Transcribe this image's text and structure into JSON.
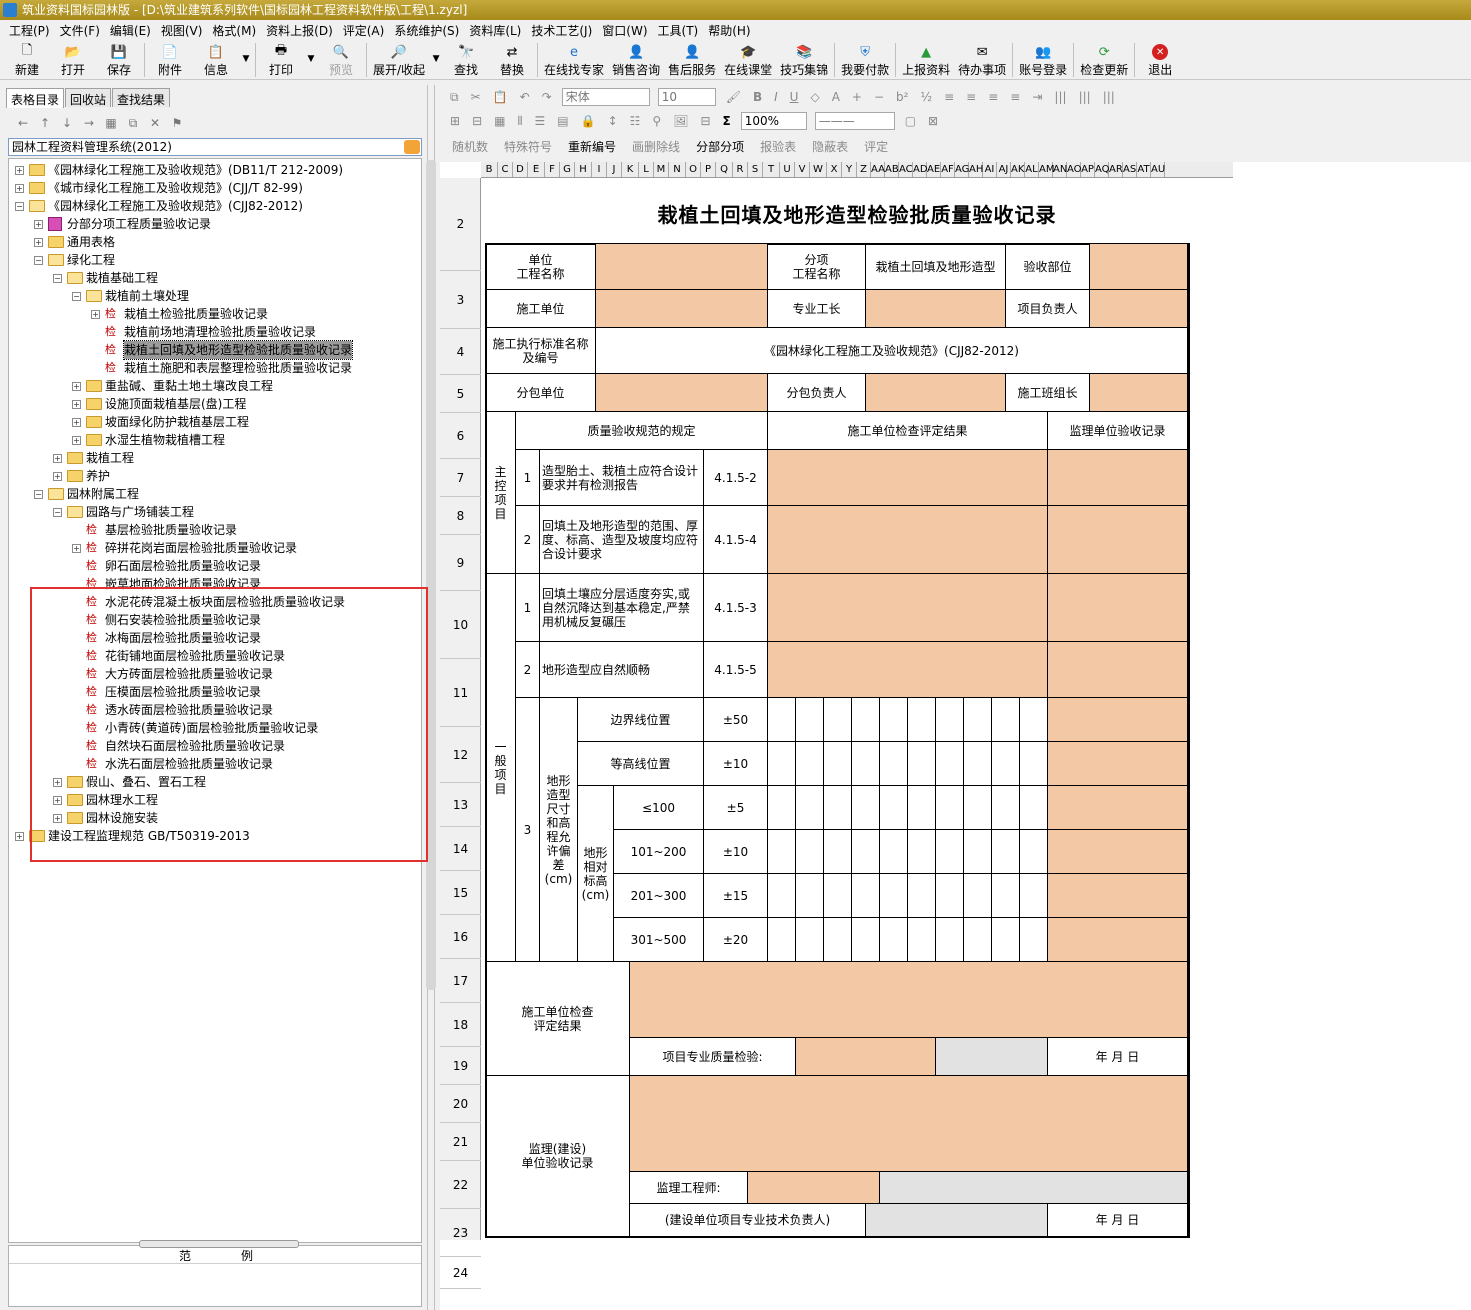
{
  "window": {
    "title": "筑业资料国标园林版 - [D:\\筑业建筑系列软件\\国标园林工程资料软件版\\工程\\1.zyzl]"
  },
  "menu": [
    "工程(P)",
    "文件(F)",
    "编辑(E)",
    "视图(V)",
    "格式(M)",
    "资料上报(D)",
    "评定(A)",
    "系统维护(S)",
    "资料库(L)",
    "技术工艺(J)",
    "窗口(W)",
    "工具(T)",
    "帮助(H)"
  ],
  "toolbar": {
    "new": "新建",
    "open": "打开",
    "save": "保存",
    "attach": "附件",
    "info": "信息",
    "print": "打印",
    "preview": "预览",
    "expand": "展开/收起",
    "find": "查找",
    "replace": "替换",
    "expert": "在线找专家",
    "sales_consult": "销售咨询",
    "after_sales": "售后服务",
    "online_class": "在线课堂",
    "tips": "技巧集锦",
    "pay": "我要付款",
    "report": "上报资料",
    "todo": "待办事项",
    "login": "账号登录",
    "update": "检查更新",
    "exit": "退出"
  },
  "left": {
    "tabs": [
      "表格目录",
      "回收站",
      "查找结果"
    ],
    "system": "园林工程资料管理系统(2012)",
    "tree": [
      {
        "label": "《园林绿化工程施工及验收规范》(DB11/T 212-2009)"
      },
      {
        "label": "《城市绿化工程施工及验收规范》(CJJ/T 82-99)"
      },
      {
        "label": "《园林绿化工程施工及验收规范》(CJJ82-2012)"
      },
      {
        "label": "分部分项工程质量验收记录"
      },
      {
        "label": "通用表格"
      },
      {
        "label": "绿化工程"
      },
      {
        "label": "栽植基础工程"
      },
      {
        "label": "栽植前土壤处理"
      },
      {
        "label": "栽植土检验批质量验收记录"
      },
      {
        "label": "栽植前场地清理检验批质量验收记录"
      },
      {
        "label": "栽植土回填及地形造型检验批质量验收记录"
      },
      {
        "label": "栽植土施肥和表层整理检验批质量验收记录"
      },
      {
        "label": "重盐碱、重黏土地土壤改良工程"
      },
      {
        "label": "设施顶面栽植基层(盘)工程"
      },
      {
        "label": "坡面绿化防护栽植基层工程"
      },
      {
        "label": "水湿生植物栽植槽工程"
      },
      {
        "label": "栽植工程"
      },
      {
        "label": "养护"
      },
      {
        "label": "园林附属工程"
      },
      {
        "label": "园路与广场铺装工程"
      },
      {
        "label": "基层检验批质量验收记录"
      },
      {
        "label": "碎拼花岗岩面层检验批质量验收记录"
      },
      {
        "label": "卵石面层检验批质量验收记录"
      },
      {
        "label": "嵌草地面检验批质量验收记录"
      },
      {
        "label": "水泥花砖混凝土板块面层检验批质量验收记录"
      },
      {
        "label": "侧石安装检验批质量验收记录"
      },
      {
        "label": "冰梅面层检验批质量验收记录"
      },
      {
        "label": "花街铺地面层检验批质量验收记录"
      },
      {
        "label": "大方砖面层检验批质量验收记录"
      },
      {
        "label": "压模面层检验批质量验收记录"
      },
      {
        "label": "透水砖面层检验批质量验收记录"
      },
      {
        "label": "小青砖(黄道砖)面层检验批质量验收记录"
      },
      {
        "label": "自然块石面层检验批质量验收记录"
      },
      {
        "label": "水洗石面层检验批质量验收记录"
      },
      {
        "label": "假山、叠石、置石工程"
      },
      {
        "label": "园林理水工程"
      },
      {
        "label": "园林设施安装"
      },
      {
        "label": "建设工程监理规范 GB/T50319-2013"
      }
    ],
    "tree_icon_char": "检",
    "legend": {
      "a": "范",
      "b": "例"
    }
  },
  "fmt": {
    "row1": [
      "随机数",
      "特殊符号",
      "重新编号",
      "画删除线",
      "分部分项",
      "报验表",
      "隐蔽表",
      "评定"
    ],
    "font": "宋体",
    "size": "10",
    "zoom": "100%"
  },
  "columns": [
    "B",
    "C",
    "D",
    "E",
    "F",
    "G",
    "H",
    "I",
    "J",
    "K",
    "L",
    "M",
    "N",
    "O",
    "P",
    "Q",
    "R",
    "S",
    "T",
    "U",
    "V",
    "W",
    "X",
    "Y",
    "Z",
    "AA",
    "AB",
    "AC",
    "AD",
    "AE",
    "AF",
    "AG",
    "AH",
    "AI",
    "AJ",
    "AK",
    "AL",
    "AM",
    "AN",
    "AO",
    "AP",
    "AQ",
    "AR",
    "AS",
    "AT",
    "AU"
  ],
  "rows": [
    "2",
    "3",
    "4",
    "5",
    "6",
    "7",
    "8",
    "9",
    "10",
    "11",
    "12",
    "13",
    "14",
    "15",
    "16",
    "17",
    "18",
    "19",
    "20",
    "21",
    "22",
    "23",
    "24"
  ],
  "form": {
    "title": "栽植土回填及地形造型检验批质量验收记录",
    "unit_project": "单位\n工程名称",
    "sub_project": "分项\n工程名称",
    "sub_project_value": "栽植土回填及地形造型",
    "acceptance_part": "验收部位",
    "contractor": "施工单位",
    "pro_manager": "专业工长",
    "project_lead": "项目负责人",
    "std_label": "施工执行标准名称\n及编号",
    "std_value": "《园林绿化工程施工及验收规范》(CJJ82-2012)",
    "subcontractor": "分包单位",
    "sub_lead": "分包负责人",
    "team_lead": "施工班组长",
    "spec_header": "质量验收规范的规定",
    "check_header": "施工单位检查评定结果",
    "super_header": "监理单位验收记录",
    "main_items": "主\n控\n项\n目",
    "general_items": "一\n般\n项\n目",
    "items": [
      {
        "no": "1",
        "text": "造型胎土、栽植土应符合设计要求并有检测报告",
        "ref": "4.1.5-2"
      },
      {
        "no": "2",
        "text": "回填土及地形造型的范围、厚度、标高、造型及坡度均应符合设计要求",
        "ref": "4.1.5-4"
      },
      {
        "no": "1",
        "text": "回填土壤应分层适度夯实,或自然沉降达到基本稳定,严禁用机械反复碾压",
        "ref": "4.1.5-3"
      },
      {
        "no": "2",
        "text": "地形造型应自然顺畅",
        "ref": "4.1.5-5"
      }
    ],
    "g3_no": "3",
    "g3_label": "地形\n造型\n尺寸\n和高\n程允\n许偏\n差\n(cm)",
    "tol": [
      {
        "name": "边界线位置",
        "val": "±50"
      },
      {
        "name": "等高线位置",
        "val": "±10"
      }
    ],
    "elev_label": "地形\n相对\n标高\n(cm)",
    "elev": [
      {
        "name": "≤100",
        "val": "±5"
      },
      {
        "name": "101~200",
        "val": "±10"
      },
      {
        "name": "201~300",
        "val": "±15"
      },
      {
        "name": "301~500",
        "val": "±20"
      }
    ],
    "contractor_result": "施工单位检查\n评定结果",
    "qc_inspector": "项目专业质量检验:",
    "date": "年  月  日",
    "supervisor_result": "监理(建设)\n单位验收记录",
    "supervisor": "监理工程师:",
    "owner_rep": "(建设单位项目专业技术负责人)"
  },
  "colors": {
    "fill": "#f2c9a4",
    "highlight_box": "#e03030",
    "titlebar": "#b89a2a"
  }
}
